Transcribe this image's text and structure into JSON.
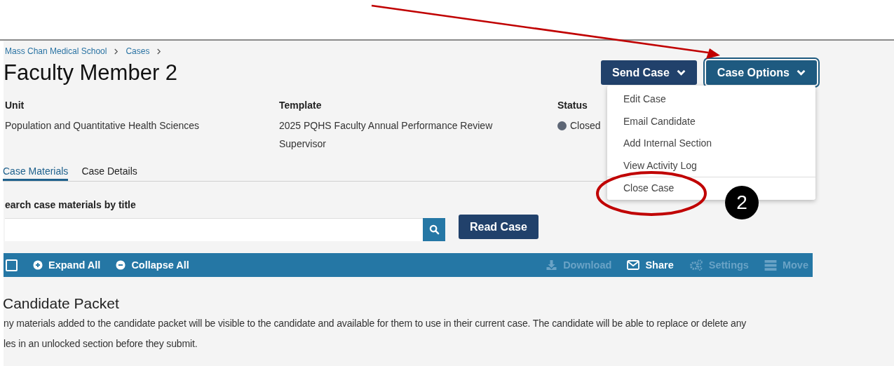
{
  "breadcrumb": [
    {
      "label": "Mass Chan Medical School"
    },
    {
      "label": "Cases"
    }
  ],
  "title": "Faculty Member 2",
  "header_buttons": [
    {
      "label": "Send Case",
      "kind": "send",
      "expanded": false
    },
    {
      "label": "Case Options",
      "kind": "options",
      "expanded": true
    }
  ],
  "menu": {
    "items": [
      {
        "kind": "item",
        "label": "Edit Case"
      },
      {
        "kind": "item",
        "label": "Email Candidate"
      },
      {
        "kind": "item",
        "label": "Add Internal Section"
      },
      {
        "kind": "item",
        "label": "View Activity Log"
      },
      {
        "kind": "separator"
      },
      {
        "kind": "item",
        "label": "Close Case"
      }
    ]
  },
  "fields": [
    {
      "label": "Unit",
      "value": "Population and Quantitative Health Sciences"
    },
    {
      "label": "Template",
      "value": "2025 PQHS Faculty Annual Performance Review Supervisor"
    },
    {
      "label": "Status",
      "value": "Closed",
      "color": "#5d6675"
    }
  ],
  "tabs": [
    {
      "label": "Case Materials",
      "selected": true
    },
    {
      "label": "Case Details",
      "selected": false
    }
  ],
  "search": {
    "label": "earch case materials by title"
  },
  "read_button": "Read Case",
  "toolbar": {
    "select_all": {
      "checked": false
    },
    "left": [
      {
        "kind": "expand",
        "label": "Expand All"
      },
      {
        "kind": "collapse",
        "label": "Collapse All"
      }
    ],
    "right": [
      {
        "kind": "download",
        "label": "Download",
        "disabled": true
      },
      {
        "kind": "share",
        "label": "Share",
        "disabled": false
      },
      {
        "kind": "settings",
        "label": "Settings",
        "disabled": true
      },
      {
        "kind": "move",
        "label": "Move",
        "disabled": true
      }
    ]
  },
  "section": {
    "heading": "Candidate Packet",
    "lines": [
      "ny materials added to the candidate packet will be visible to the candidate and available for them to use in their current case. The candidate will be able to replace or delete any",
      "les in an unlocked section before they submit."
    ]
  },
  "annotation": {
    "step": "2"
  }
}
